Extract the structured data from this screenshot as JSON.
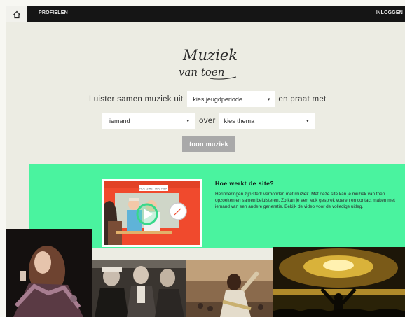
{
  "nav": {
    "home_icon": "home-icon",
    "profielen": "PROFIELEN",
    "inloggen": "INLOGGEN"
  },
  "logo": {
    "line1": "Muziek",
    "line2": "van toen"
  },
  "form": {
    "intro": "Luister samen muziek uit",
    "period_value": "kies jeugdperiode",
    "connector1": "en praat met",
    "person_value": "iemand",
    "connector2": "over",
    "theme_value": "kies thema",
    "arrow": "▾",
    "button": "toon muziek"
  },
  "info": {
    "title": "Hoe werkt de site?",
    "text": "Herinneringen zijn sterk verbonden met muziek. Met deze site kan je muziek van toen opzoeken en samen beluisteren. Zo kan je een leuk gesprek voeren en contact maken met iemand van een andere generatie. Bekijk de video voor de volledige uitleg.",
    "video_caption": "HOE IS HET NOU HIER",
    "video_icon": "play-icon"
  },
  "colors": {
    "topbar": "#151515",
    "background": "#ecece3",
    "accent_green": "#4af39f",
    "button": "#a9a9a9"
  }
}
